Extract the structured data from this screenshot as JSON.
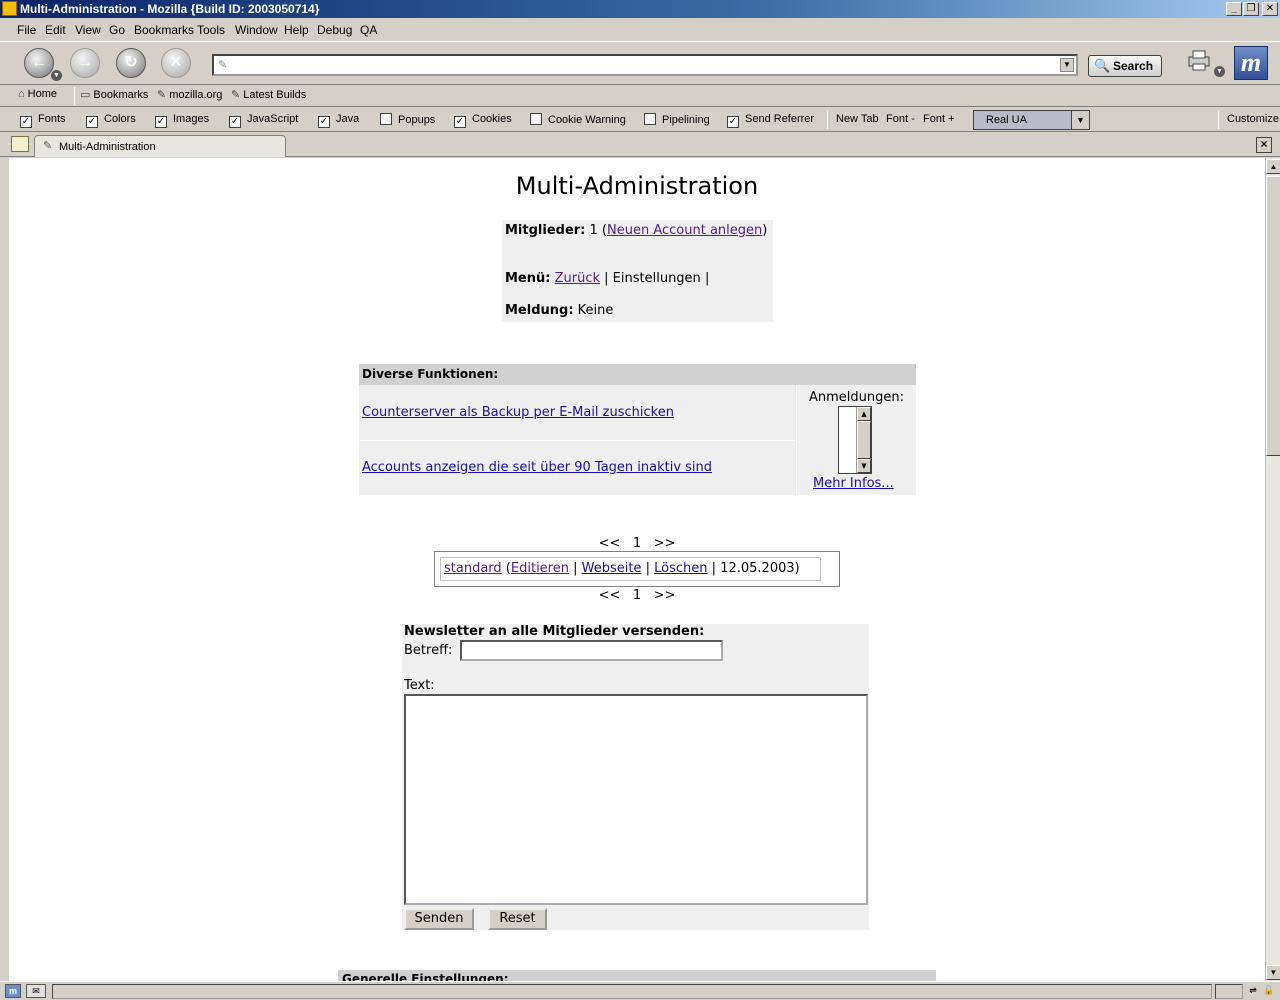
{
  "window": {
    "title": "Multi-Administration - Mozilla {Build ID: 2003050714}",
    "minimize": "_",
    "restore": "❐",
    "close": "✕"
  },
  "menu": [
    "File",
    "Edit",
    "View",
    "Go",
    "Bookmarks",
    "Tools",
    "Window",
    "Help",
    "Debug",
    "QA"
  ],
  "nav": {
    "back_icon": "←",
    "forward_icon": "→",
    "reload_icon": "↻",
    "stop_icon": "✕",
    "url": "",
    "search_label": "Search",
    "logo": "m"
  },
  "personal": {
    "home": "Home",
    "bookmarks": "Bookmarks",
    "mozilla": "mozilla.org",
    "latest": "Latest Builds"
  },
  "prefbar": {
    "checkboxes": [
      {
        "label": "Fonts",
        "checked": true
      },
      {
        "label": "Colors",
        "checked": true
      },
      {
        "label": "Images",
        "checked": true
      },
      {
        "label": "JavaScript",
        "checked": true
      },
      {
        "label": "Java",
        "checked": true
      },
      {
        "label": "Popups",
        "checked": false
      },
      {
        "label": "Cookies",
        "checked": true
      },
      {
        "label": "Cookie Warning",
        "checked": false
      },
      {
        "label": "Pipelining",
        "checked": false
      },
      {
        "label": "Send Referrer",
        "checked": true
      }
    ],
    "new_tab": "New Tab",
    "font_minus": "Font -",
    "font_plus": "Font +",
    "ua_value": "Real UA",
    "customize": "Customize"
  },
  "tabs": {
    "active_label": "Multi-Administration"
  },
  "page": {
    "title": "Multi-Administration",
    "mitglieder_label": "Mitglieder:",
    "mitglieder_count": "1",
    "new_account_link": "Neuen Account anlegen",
    "menu_label": "Menü:",
    "menu_back_link": "Zurück",
    "menu_settings": "Einstellungen",
    "meldung_label": "Meldung:",
    "meldung_value": "Keine",
    "functions_header": "Diverse Funktionen:",
    "func_backup_link": "Counterserver als Backup per E-Mail zuschicken",
    "func_inactive_link": "Accounts anzeigen die seit über 90 Tagen inaktiv sind",
    "anmeldungen_label": "Anmeldungen:",
    "mehr_infos_link": "Mehr Infos...",
    "pager_prev": "<<",
    "pager_page": "1",
    "pager_next": ">>",
    "entry": {
      "name_link": "standard",
      "edit_link": "Editieren",
      "website_link": "Webseite",
      "delete_link": "Löschen",
      "date": "12.05.2003"
    },
    "newsletter_header": "Newsletter an alle Mitglieder versenden:",
    "betreff_label": "Betreff:",
    "betreff_value": "",
    "text_label": "Text:",
    "text_value": "",
    "send_button": "Senden",
    "reset_button": "Reset",
    "bottom_header": "Generelle Einstellungen:"
  }
}
